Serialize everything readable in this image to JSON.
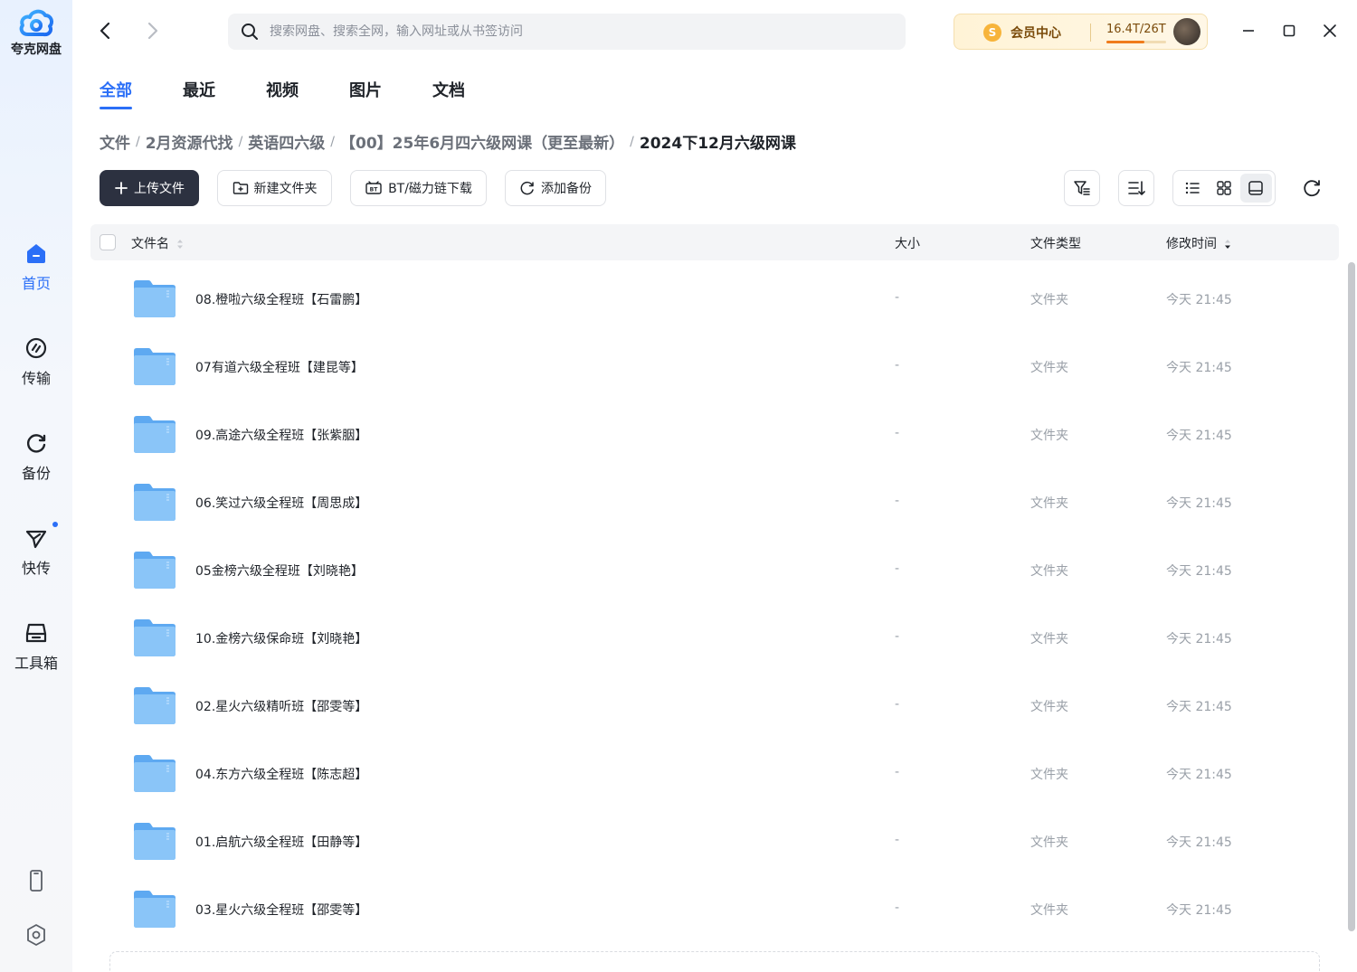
{
  "app": {
    "name": "夸克网盘"
  },
  "sidebar": {
    "items": [
      {
        "label": "首页",
        "icon": "home-icon",
        "active": true
      },
      {
        "label": "传输",
        "icon": "transfer-icon"
      },
      {
        "label": "备份",
        "icon": "backup-icon"
      },
      {
        "label": "快传",
        "icon": "send-icon",
        "has_dot": true
      },
      {
        "label": "工具箱",
        "icon": "toolbox-icon"
      }
    ],
    "bottom_icons": [
      "phone-icon",
      "settings-icon"
    ]
  },
  "search": {
    "placeholder": "搜索网盘、搜索全网，输入网址或从书签访问"
  },
  "vip": {
    "label": "会员中心",
    "quota": "16.4T/26T",
    "usage_fraction": 0.63,
    "coin_glyph": "S"
  },
  "tabs": [
    "全部",
    "最近",
    "视频",
    "图片",
    "文档"
  ],
  "active_tab": 0,
  "breadcrumb": [
    "文件",
    "2月资源代找",
    "英语四六级",
    "【00】25年6月四六级网课（更至最新）",
    "2024下12月六级网课"
  ],
  "toolbar": {
    "upload": "上传文件",
    "new_folder": "新建文件夹",
    "bt_download": "BT/磁力链下载",
    "add_backup": "添加备份"
  },
  "table": {
    "headers": {
      "name": "文件名",
      "size": "大小",
      "type": "文件类型",
      "modified": "修改时间"
    },
    "rows": [
      {
        "name": "08.橙啦六级全程班【石雷鹏】",
        "size": "-",
        "type": "文件夹",
        "modified": "今天 21:45"
      },
      {
        "name": "07有道六级全程班【建昆等】",
        "size": "-",
        "type": "文件夹",
        "modified": "今天 21:45"
      },
      {
        "name": "09.高途六级全程班【张紫胭】",
        "size": "-",
        "type": "文件夹",
        "modified": "今天 21:45"
      },
      {
        "name": "06.笑过六级全程班【周思成】",
        "size": "-",
        "type": "文件夹",
        "modified": "今天 21:45"
      },
      {
        "name": "05金榜六级全程班【刘晓艳】",
        "size": "-",
        "type": "文件夹",
        "modified": "今天 21:45"
      },
      {
        "name": "10.金榜六级保命班【刘晓艳】",
        "size": "-",
        "type": "文件夹",
        "modified": "今天 21:45"
      },
      {
        "name": "02.星火六级精听班【邵雯等】",
        "size": "-",
        "type": "文件夹",
        "modified": "今天 21:45"
      },
      {
        "name": "04.东方六级全程班【陈志超】",
        "size": "-",
        "type": "文件夹",
        "modified": "今天 21:45"
      },
      {
        "name": "01.启航六级全程班【田静等】",
        "size": "-",
        "type": "文件夹",
        "modified": "今天 21:45"
      },
      {
        "name": "03.星火六级全程班【邵雯等】",
        "size": "-",
        "type": "文件夹",
        "modified": "今天 21:45"
      }
    ]
  },
  "colors": {
    "accent": "#2b6ff7",
    "primary_button": "#2c3140",
    "folder": "#6fb2f3"
  }
}
